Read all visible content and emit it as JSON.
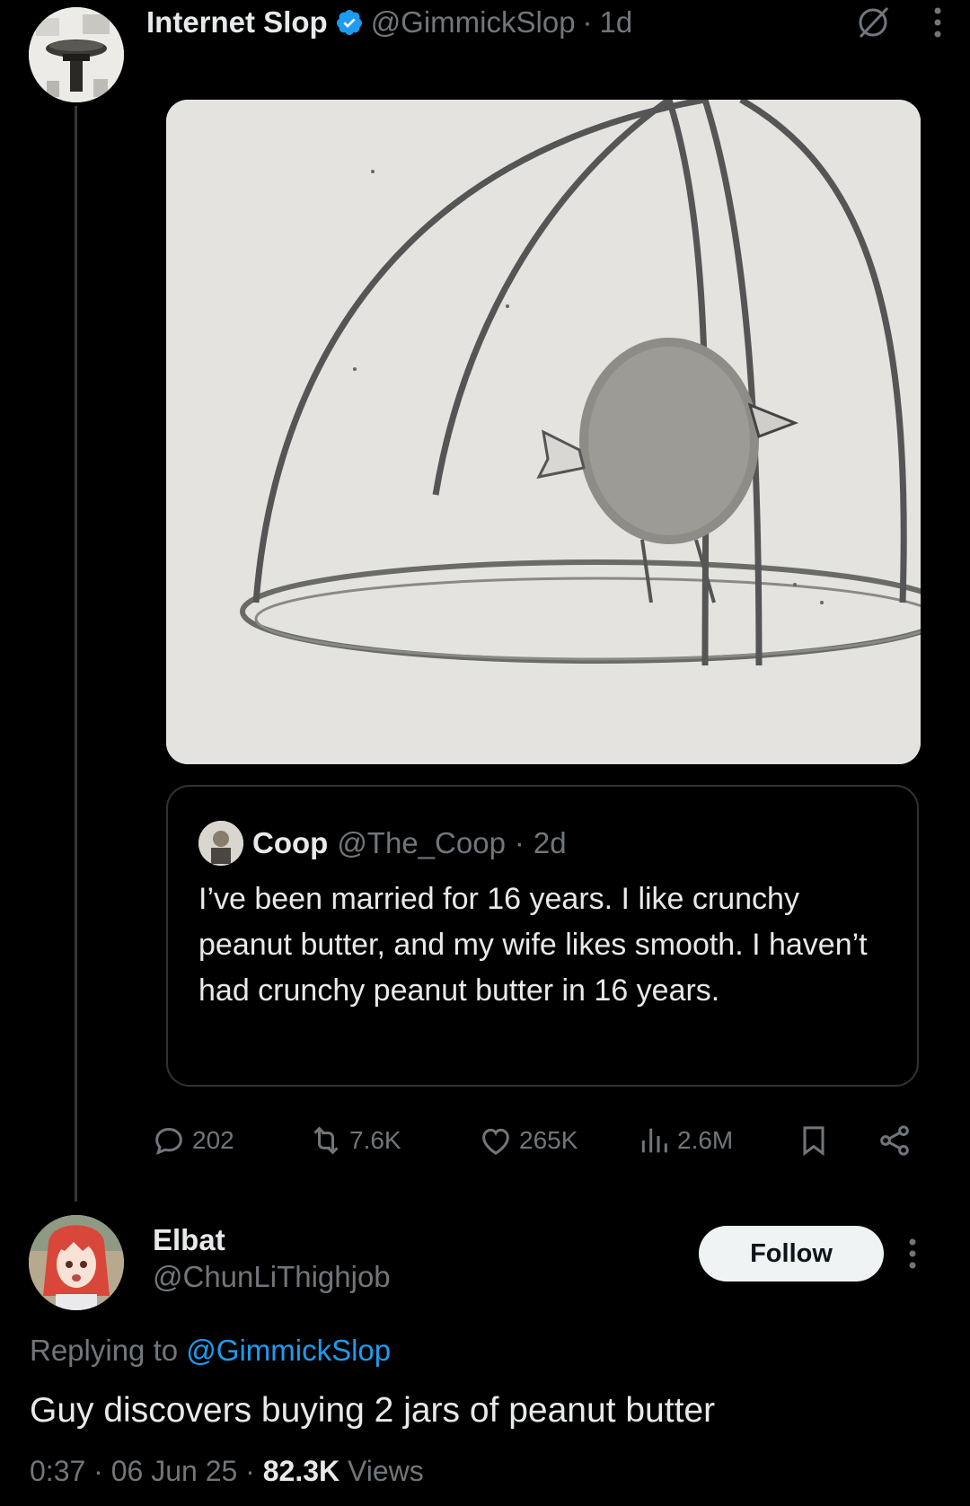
{
  "parent_tweet": {
    "author_name": "Internet Slop",
    "author_handle": "@GimmickSlop",
    "separator": "·",
    "age": "1d",
    "icons": {
      "verified": "verified-badge-icon",
      "grok": "grok-icon",
      "more": "more-vertical-icon"
    },
    "media": {
      "description_icon": "bird-in-cage-drawing"
    },
    "quoted_tweet": {
      "author_name": "Coop",
      "author_handle": "@The_Coop",
      "separator": "·",
      "age": "2d",
      "text": "I’ve been married for 16 years.  I like crunchy peanut butter, and my wife likes smooth.  I haven’t had crunchy peanut butter in 16 years."
    },
    "actions": {
      "replies": "202",
      "reposts": "7.6K",
      "likes": "265K",
      "views": "2.6M"
    }
  },
  "reply_tweet": {
    "author_name": "Elbat",
    "author_handle": "@ChunLiThighjob",
    "follow_label": "Follow",
    "replying_prefix": "Replying to",
    "replying_mention": "@GimmickSlop",
    "text": "Guy discovers buying 2 jars of peanut butter",
    "time": "0:37 · 06 Jun 25 · ",
    "views_count": "82.3K",
    "views_label": " Views"
  },
  "colors": {
    "background": "#000000",
    "text_primary": "#e7e9ea",
    "text_secondary": "#71767b",
    "accent": "#1d9bf0",
    "border": "#2f3336"
  }
}
